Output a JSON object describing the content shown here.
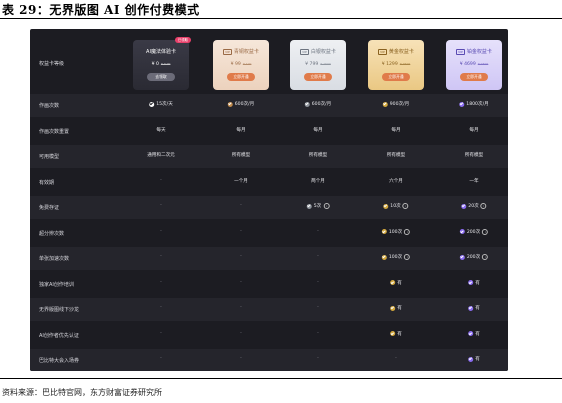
{
  "doc": {
    "title": "表 29：无界版图 AI 创作付费模式",
    "source": "资料来源：巴比特官网，东方财富证券研究所"
  },
  "header_label": "权益卡等级",
  "cards": [
    {
      "name": "AI魔法体验卡",
      "price": "¥ 0",
      "old_price": "¥ 9.99",
      "button": "去领取",
      "badge": "已领取",
      "tag": ""
    },
    {
      "name": "青铜权益卡",
      "price": "¥ 99",
      "old_price": "¥ 199",
      "button": "立即开通",
      "badge": "",
      "tag": "VIP"
    },
    {
      "name": "白银权益卡",
      "price": "¥ 799",
      "old_price": "¥ 1599",
      "button": "立即开通",
      "badge": "",
      "tag": "VIP"
    },
    {
      "name": "黄金权益卡",
      "price": "¥ 1299",
      "old_price": "¥ 2599",
      "button": "立即开通",
      "badge": "",
      "tag": "VIP"
    },
    {
      "name": "铂金权益卡",
      "price": "¥ 4699",
      "old_price": "¥ 9399",
      "button": "立即开通",
      "badge": "",
      "tag": "VIP"
    }
  ],
  "rows": [
    {
      "label": "作画次数",
      "cells": [
        {
          "text": "15次/天",
          "check": "white"
        },
        {
          "text": "600次/月",
          "check": "bronze"
        },
        {
          "text": "600次/月",
          "check": "silver"
        },
        {
          "text": "900次/月",
          "check": "gold"
        },
        {
          "text": "1800次/月",
          "check": "purple"
        }
      ]
    },
    {
      "label": "作画次数重置",
      "cells": [
        {
          "text": "每天"
        },
        {
          "text": "每月"
        },
        {
          "text": "每月"
        },
        {
          "text": "每月"
        },
        {
          "text": "每月"
        }
      ]
    },
    {
      "label": "可用模型",
      "cells": [
        {
          "text": "通用和二次元"
        },
        {
          "text": "所有模型"
        },
        {
          "text": "所有模型"
        },
        {
          "text": "所有模型"
        },
        {
          "text": "所有模型"
        }
      ]
    },
    {
      "label": "有效期",
      "cells": [
        {
          "text": "-"
        },
        {
          "text": "一个月"
        },
        {
          "text": "两个月"
        },
        {
          "text": "六个月"
        },
        {
          "text": "一年"
        }
      ]
    },
    {
      "label": "免费存证",
      "cells": [
        {
          "text": "-"
        },
        {
          "text": "-"
        },
        {
          "text": "5次",
          "check": "silver",
          "info": true
        },
        {
          "text": "10次",
          "check": "gold",
          "info": true
        },
        {
          "text": "20次",
          "check": "purple",
          "info": true
        }
      ]
    },
    {
      "label": "超分辨次数",
      "cells": [
        {
          "text": "-"
        },
        {
          "text": "-"
        },
        {
          "text": "-"
        },
        {
          "text": "100次",
          "check": "gold",
          "info": true
        },
        {
          "text": "200次",
          "check": "purple",
          "info": true
        }
      ]
    },
    {
      "label": "单张加速次数",
      "cells": [
        {
          "text": "-"
        },
        {
          "text": "-"
        },
        {
          "text": "-"
        },
        {
          "text": "100次",
          "check": "gold",
          "info": true
        },
        {
          "text": "200次",
          "check": "purple",
          "info": true
        }
      ]
    },
    {
      "label": "独家AI创作培训",
      "cells": [
        {
          "text": "-"
        },
        {
          "text": "-"
        },
        {
          "text": "-"
        },
        {
          "text": "有",
          "check": "gold"
        },
        {
          "text": "有",
          "check": "purple"
        }
      ]
    },
    {
      "label": "无界版图线下沙龙",
      "cells": [
        {
          "text": "-"
        },
        {
          "text": "-"
        },
        {
          "text": "-"
        },
        {
          "text": "有",
          "check": "gold"
        },
        {
          "text": "有",
          "check": "purple"
        }
      ]
    },
    {
      "label": "AI创作者优先认证",
      "cells": [
        {
          "text": "-"
        },
        {
          "text": "-"
        },
        {
          "text": "-"
        },
        {
          "text": "有",
          "check": "gold"
        },
        {
          "text": "有",
          "check": "purple"
        }
      ]
    },
    {
      "label": "巴比特大会入场券",
      "cells": [
        {
          "text": "-"
        },
        {
          "text": "-"
        },
        {
          "text": "-"
        },
        {
          "text": "-"
        },
        {
          "text": "有",
          "check": "purple"
        }
      ]
    }
  ]
}
